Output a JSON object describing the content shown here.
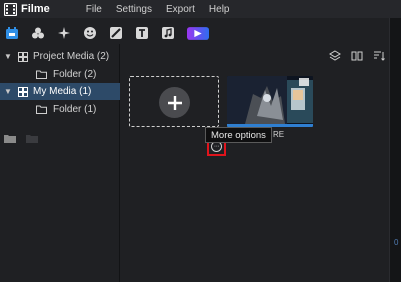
{
  "app": {
    "name": "Filme"
  },
  "menu": [
    "File",
    "Settings",
    "Export",
    "Help"
  ],
  "toolbar": {
    "icons": [
      "media-icon",
      "effects-icon",
      "sparkle-icon",
      "sticker-icon",
      "transition-icon",
      "text-icon",
      "music-icon",
      "ai-icon"
    ]
  },
  "sidebar": {
    "items": [
      {
        "label": "Project Media (2)"
      },
      {
        "label": "Folder (2)"
      },
      {
        "label": "My Media (1)"
      },
      {
        "label": "Folder (1)"
      }
    ]
  },
  "main": {
    "thumbnail_caption": "RE",
    "more_options_tooltip": "More options",
    "more_button_glyph": "···"
  },
  "right_strip": {
    "label": "0"
  },
  "colors": {
    "accent_blue": "#2f7fd1",
    "selected_row": "#2d4a68",
    "highlight_red": "#e0141c"
  }
}
